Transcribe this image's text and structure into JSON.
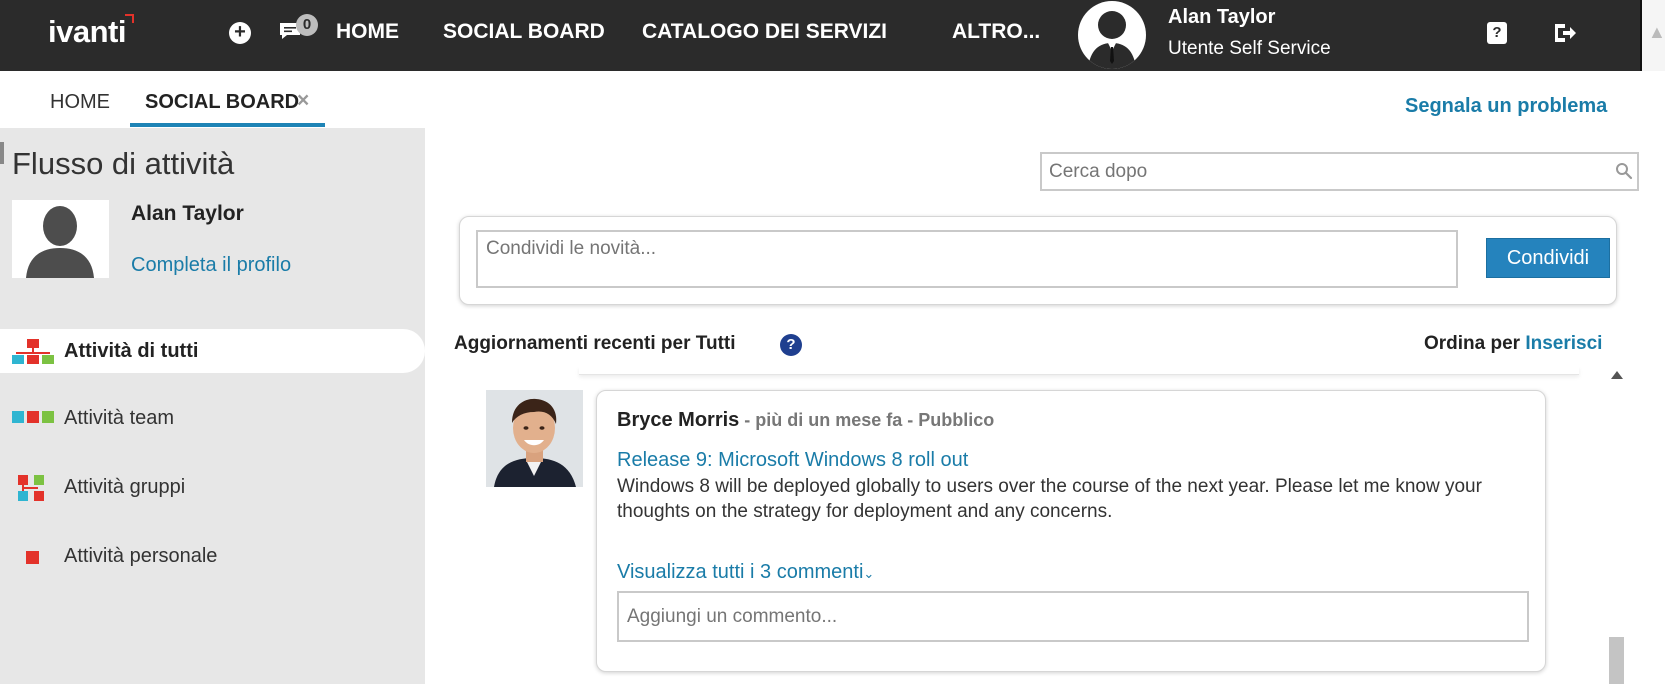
{
  "app": {
    "logo": "ivanti"
  },
  "topbar": {
    "notifications_count": "0",
    "nav": [
      "HOME",
      "SOCIAL BOARD",
      "CATALOGO DEI SERVIZI",
      "ALTRO..."
    ],
    "user_name": "Alan Taylor",
    "user_role": "Utente Self Service",
    "help_icon": "help-icon",
    "logout_icon": "logout-icon"
  },
  "tabs": {
    "home": "HOME",
    "social": "SOCIAL BOARD",
    "close": "×",
    "report_link": "Segnala un problema"
  },
  "sidebar": {
    "title": "Flusso di attività",
    "profile_name": "Alan Taylor",
    "profile_link": "Completa il profilo",
    "filters": [
      {
        "label": "Attività di tutti",
        "active": true,
        "icon": "org-chart-icon"
      },
      {
        "label": "Attività team",
        "active": false,
        "icon": "team-icon"
      },
      {
        "label": "Attività gruppi",
        "active": false,
        "icon": "groups-icon"
      },
      {
        "label": "Attività personale",
        "active": false,
        "icon": "personal-icon"
      }
    ]
  },
  "search": {
    "placeholder": "Cerca dopo"
  },
  "share": {
    "placeholder": "Condividi le novità...",
    "button": "Condividi"
  },
  "updates": {
    "title": "Aggiornamenti recenti per Tutti",
    "sort_label": "Ordina per",
    "sort_value": "Inserisci"
  },
  "post": {
    "author": "Bryce Morris",
    "meta": " - più di un mese fa - Pubblico",
    "title": "Release 9: Microsoft Windows 8 roll out",
    "body": "Windows 8 will be deployed globally to users over the course of the next year. Please let me know your thoughts on the strategy for deployment and any concerns.",
    "comments_link": "Visualizza tutti i 3 commenti",
    "comment_placeholder": "Aggiungi un commento..."
  },
  "colors": {
    "topbar": "#2b2b2b",
    "accent": "#1a7ca8",
    "button": "#2583bd",
    "sidebar": "#e7e7e7"
  }
}
